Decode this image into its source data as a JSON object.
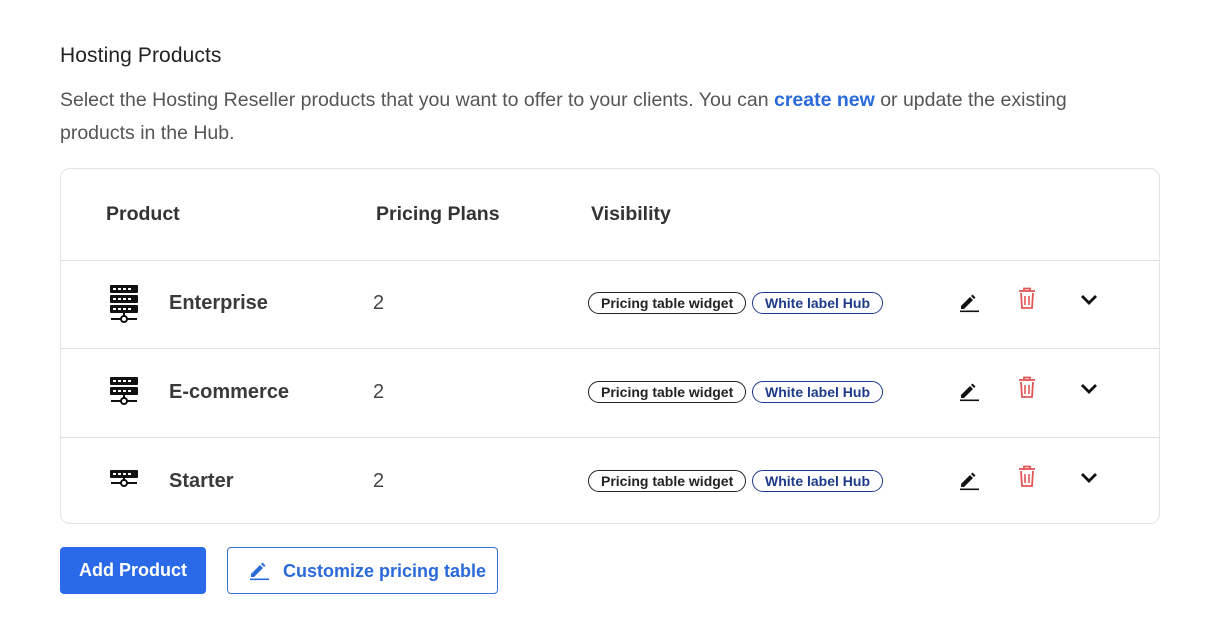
{
  "section": {
    "title": "Hosting Products",
    "desc_before": "Select the Hosting Reseller products that you want to offer to your clients. You can ",
    "desc_link": "create new",
    "desc_after": " or update the existing products in the Hub."
  },
  "table": {
    "headers": {
      "product": "Product",
      "plans": "Pricing Plans",
      "visibility": "Visibility"
    },
    "rows": [
      {
        "name": "Enterprise",
        "plans": "2",
        "badge1": "Pricing table widget",
        "badge2": "White label Hub",
        "icon": "server-large-icon"
      },
      {
        "name": "E-commerce",
        "plans": "2",
        "badge1": "Pricing table widget",
        "badge2": "White label Hub",
        "icon": "server-medium-icon"
      },
      {
        "name": "Starter",
        "plans": "2",
        "badge1": "Pricing table widget",
        "badge2": "White label Hub",
        "icon": "server-small-icon"
      }
    ]
  },
  "buttons": {
    "add_product": "Add Product",
    "customize": "Customize pricing table"
  },
  "colors": {
    "primary": "#2a6ae8",
    "link": "#2a6ad9",
    "delete": "#e25555",
    "badge_blue": "#1e3a8a"
  }
}
